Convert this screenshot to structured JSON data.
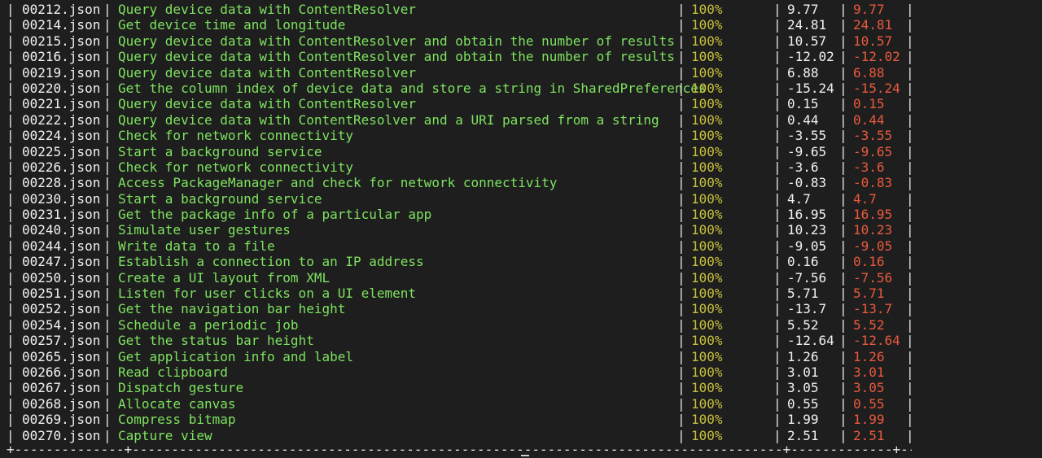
{
  "table": {
    "rows": [
      {
        "file": "00212.json",
        "description": "Query device data with ContentResolver",
        "percent": "100%",
        "value": "9.77",
        "value_red": "9.77"
      },
      {
        "file": "00214.json",
        "description": "Get device time and longitude",
        "percent": "100%",
        "value": "24.81",
        "value_red": "24.81"
      },
      {
        "file": "00215.json",
        "description": "Query device data with ContentResolver and obtain the number of results",
        "percent": "100%",
        "value": "10.57",
        "value_red": "10.57"
      },
      {
        "file": "00216.json",
        "description": "Query device data with ContentResolver and obtain the number of results",
        "percent": "100%",
        "value": "-12.02",
        "value_red": "-12.02"
      },
      {
        "file": "00219.json",
        "description": "Query device data with ContentResolver",
        "percent": "100%",
        "value": "6.88",
        "value_red": "6.88"
      },
      {
        "file": "00220.json",
        "description": "Get the column index of device data and store a string in SharedPreferences",
        "percent": "100%",
        "value": "-15.24",
        "value_red": "-15.24"
      },
      {
        "file": "00221.json",
        "description": "Query device data with ContentResolver",
        "percent": "100%",
        "value": "0.15",
        "value_red": "0.15"
      },
      {
        "file": "00222.json",
        "description": "Query device data with ContentResolver and a URI parsed from a string",
        "percent": "100%",
        "value": "0.44",
        "value_red": "0.44"
      },
      {
        "file": "00224.json",
        "description": "Check for network connectivity",
        "percent": "100%",
        "value": "-3.55",
        "value_red": "-3.55"
      },
      {
        "file": "00225.json",
        "description": "Start a background service",
        "percent": "100%",
        "value": "-9.65",
        "value_red": "-9.65"
      },
      {
        "file": "00226.json",
        "description": "Check for network connectivity",
        "percent": "100%",
        "value": "-3.6",
        "value_red": "-3.6"
      },
      {
        "file": "00228.json",
        "description": "Access PackageManager and check for network connectivity",
        "percent": "100%",
        "value": "-0.83",
        "value_red": "-0.83"
      },
      {
        "file": "00230.json",
        "description": "Start a background service",
        "percent": "100%",
        "value": "4.7",
        "value_red": "4.7"
      },
      {
        "file": "00231.json",
        "description": "Get the package info of a particular app",
        "percent": "100%",
        "value": "16.95",
        "value_red": "16.95"
      },
      {
        "file": "00240.json",
        "description": "Simulate user gestures",
        "percent": "100%",
        "value": "10.23",
        "value_red": "10.23"
      },
      {
        "file": "00244.json",
        "description": "Write data to a file",
        "percent": "100%",
        "value": "-9.05",
        "value_red": "-9.05"
      },
      {
        "file": "00247.json",
        "description": "Establish a connection to an IP address",
        "percent": "100%",
        "value": "0.16",
        "value_red": "0.16"
      },
      {
        "file": "00250.json",
        "description": "Create a UI layout from XML",
        "percent": "100%",
        "value": "-7.56",
        "value_red": "-7.56"
      },
      {
        "file": "00251.json",
        "description": "Listen for user clicks on a UI element",
        "percent": "100%",
        "value": "5.71",
        "value_red": "5.71"
      },
      {
        "file": "00252.json",
        "description": "Get the navigation bar height",
        "percent": "100%",
        "value": "-13.7",
        "value_red": "-13.7"
      },
      {
        "file": "00254.json",
        "description": "Schedule a periodic job",
        "percent": "100%",
        "value": "5.52",
        "value_red": "5.52"
      },
      {
        "file": "00257.json",
        "description": "Get the status bar height",
        "percent": "100%",
        "value": "-12.64",
        "value_red": "-12.64"
      },
      {
        "file": "00265.json",
        "description": "Get application info and label",
        "percent": "100%",
        "value": "1.26",
        "value_red": "1.26"
      },
      {
        "file": "00266.json",
        "description": "Read clipboard",
        "percent": "100%",
        "value": "3.01",
        "value_red": "3.01"
      },
      {
        "file": "00267.json",
        "description": "Dispatch gesture",
        "percent": "100%",
        "value": "3.05",
        "value_red": "3.05"
      },
      {
        "file": "00268.json",
        "description": "Allocate canvas",
        "percent": "100%",
        "value": "0.55",
        "value_red": "0.55"
      },
      {
        "file": "00269.json",
        "description": "Compress bitmap",
        "percent": "100%",
        "value": "1.99",
        "value_red": "1.99"
      },
      {
        "file": "00270.json",
        "description": "Capture view",
        "percent": "100%",
        "value": "2.51",
        "value_red": "2.51"
      }
    ],
    "separator": "|",
    "bottom_border": "+--------------+-----------------------------------------------------------------------------------+-------------+---------+---------+"
  },
  "colors": {
    "background": "#1e1e1e",
    "file": "#f2f2f2",
    "description": "#7ee35f",
    "percent": "#c8c13a",
    "value": "#f2f2f2",
    "value_red": "#ea5a3d"
  }
}
